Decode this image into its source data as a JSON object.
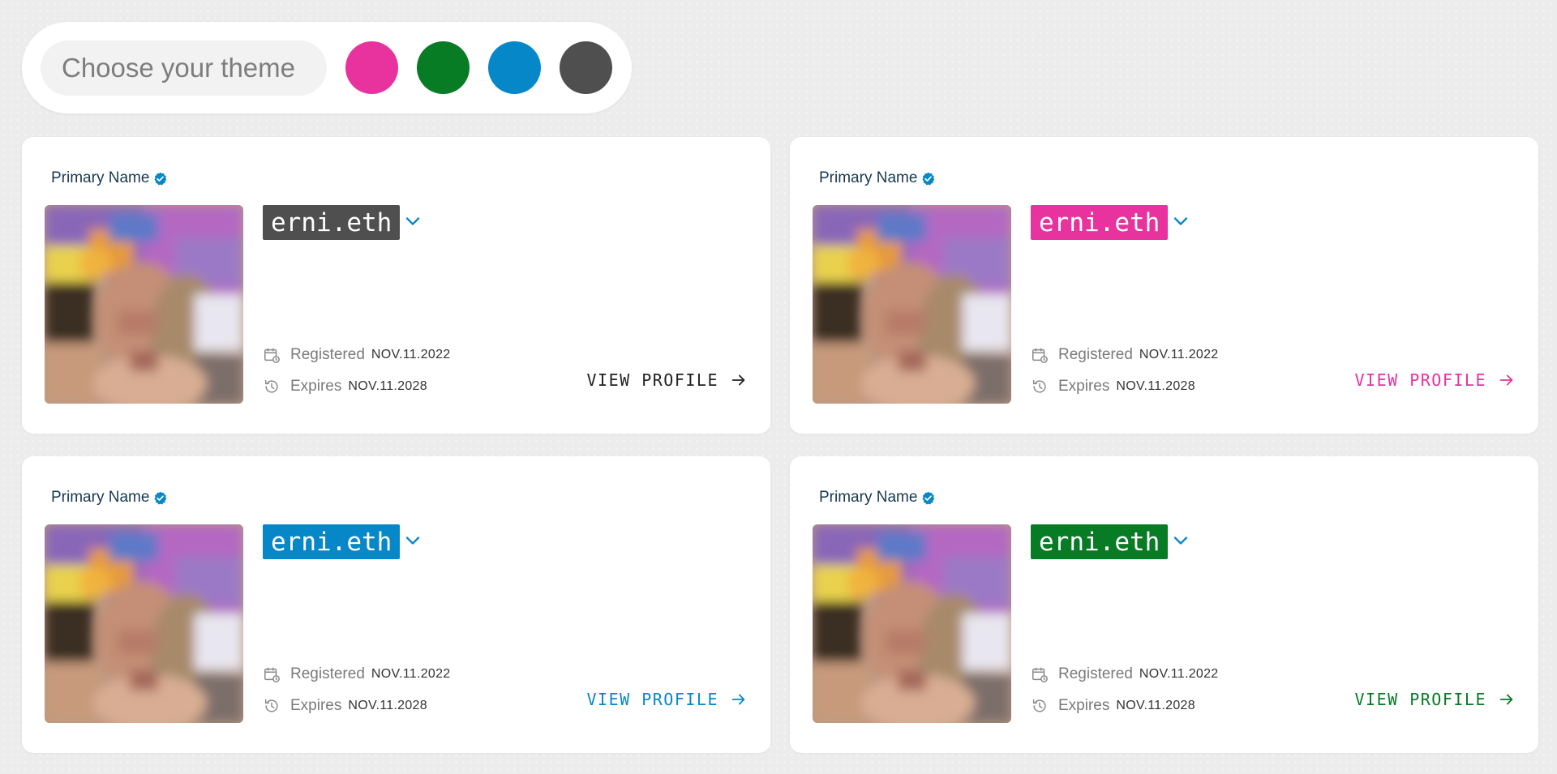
{
  "theme_picker": {
    "label": "Choose your theme",
    "swatches": [
      {
        "name": "pink",
        "color": "#e8329e"
      },
      {
        "name": "green",
        "color": "#087b25"
      },
      {
        "name": "blue",
        "color": "#0688c8"
      },
      {
        "name": "grey",
        "color": "#4f4f4f"
      }
    ]
  },
  "cards": [
    {
      "theme": "grey",
      "accent": "#4f4f4f",
      "link_color": "#222222",
      "primary_label": "Primary Name",
      "name": "erni.eth",
      "registered_label": "Registered",
      "registered_date": "NOV.11.2022",
      "expires_label": "Expires",
      "expires_date": "NOV.11.2028",
      "view_profile_label": "VIEW PROFILE"
    },
    {
      "theme": "pink",
      "accent": "#e8329e",
      "link_color": "#e8329e",
      "primary_label": "Primary Name",
      "name": "erni.eth",
      "registered_label": "Registered",
      "registered_date": "NOV.11.2022",
      "expires_label": "Expires",
      "expires_date": "NOV.11.2028",
      "view_profile_label": "VIEW PROFILE"
    },
    {
      "theme": "blue",
      "accent": "#0688c8",
      "link_color": "#0688c8",
      "primary_label": "Primary Name",
      "name": "erni.eth",
      "registered_label": "Registered",
      "registered_date": "NOV.11.2022",
      "expires_label": "Expires",
      "expires_date": "NOV.11.2028",
      "view_profile_label": "VIEW PROFILE"
    },
    {
      "theme": "green",
      "accent": "#087b25",
      "link_color": "#087b25",
      "primary_label": "Primary Name",
      "name": "erni.eth",
      "registered_label": "Registered",
      "registered_date": "NOV.11.2022",
      "expires_label": "Expires",
      "expires_date": "NOV.11.2028",
      "view_profile_label": "VIEW PROFILE"
    }
  ],
  "colors": {
    "verified_blue": "#0688c8",
    "chevron_blue": "#0688c8",
    "background": "#ececec",
    "card": "#ffffff"
  },
  "icons": {
    "verified": "check-circle-icon",
    "chevron": "chevron-down-icon",
    "registered": "calendar-clock-icon",
    "expires": "history-icon",
    "view_profile": "arrow-right-icon"
  }
}
